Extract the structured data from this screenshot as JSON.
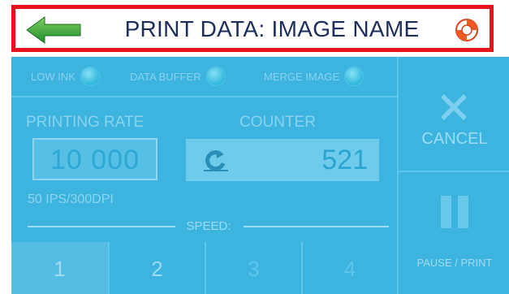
{
  "header": {
    "title": "PRINT DATA: IMAGE NAME",
    "back_icon": "back-arrow-icon",
    "help_icon": "lifebuoy-icon",
    "border_color": "#e8141d"
  },
  "status": {
    "low_ink": "LOW INK",
    "data_buffer": "DATA BUFFER",
    "merge_image": "MERGE IMAGE"
  },
  "printing_rate": {
    "label": "PRINTING RATE",
    "value": "10 000",
    "sub": "50 IPS/300DPI"
  },
  "counter": {
    "label": "COUNTER",
    "value": "521",
    "reset_icon": "reset-icon"
  },
  "speed": {
    "label": "SPEED:",
    "buttons": [
      "1",
      "2",
      "3",
      "4"
    ]
  },
  "actions": {
    "cancel": "CANCEL",
    "pause_print": "PAUSE / PRINT"
  },
  "colors": {
    "panel": "#3db3df",
    "accent_green": "#34a63a"
  }
}
